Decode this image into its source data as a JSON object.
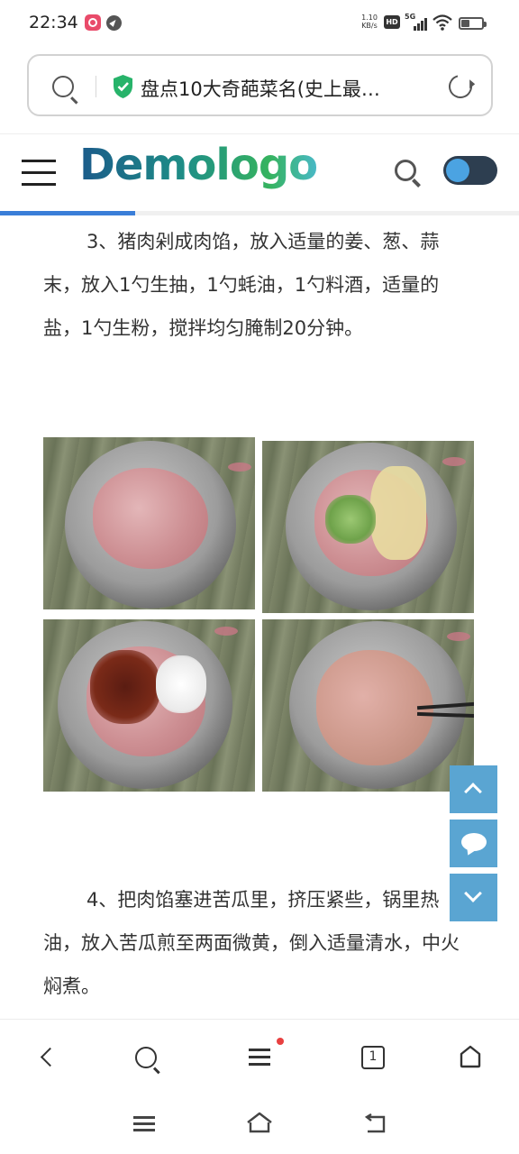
{
  "status_bar": {
    "time": "22:34",
    "net_speed_value": "1.10",
    "net_speed_unit": "KB/s",
    "hd_label": "HD",
    "signal_label": "5G"
  },
  "address_bar": {
    "title": "盘点10大奇葩菜名(史上最…"
  },
  "site": {
    "logo": "Demologo",
    "reading_progress": 0.26
  },
  "article": {
    "step3": "3、猪肉剁成肉馅，放入适量的姜、葱、蒜末，放入1勺生抽，1勺蚝油，1勺料酒，适量的盐，1勺生粉，搅拌均匀腌制20分钟。",
    "step4": "4、把肉馅塞进苦瓜里，挤压紧些，锅里热油，放入苦瓜煎至两面微黄，倒入适量清水，中火焖煮。"
  },
  "toolbar": {
    "tab_count": "1",
    "has_notification": true
  },
  "colors": {
    "accent": "#3a7ed8",
    "float_button": "#5aa5d2",
    "toggle_bg": "#2d3e50",
    "toggle_knob": "#4ba3e2"
  }
}
